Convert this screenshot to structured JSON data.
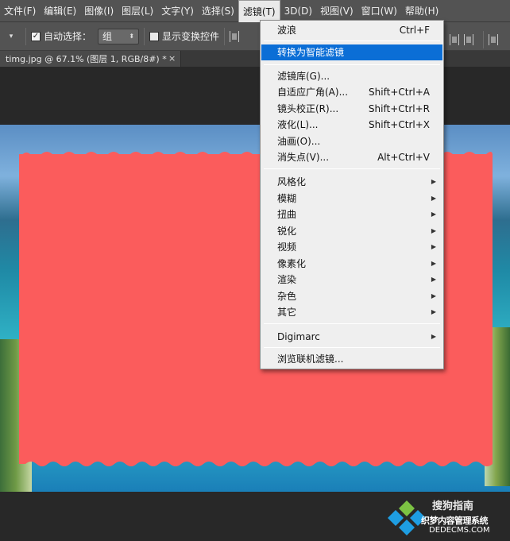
{
  "menubar": {
    "items": [
      "文件(F)",
      "编辑(E)",
      "图像(I)",
      "图层(L)",
      "文字(Y)",
      "选择(S)",
      "滤镜(T)",
      "3D(D)",
      "视图(V)",
      "窗口(W)",
      "帮助(H)"
    ],
    "active_index": 6
  },
  "options": {
    "auto_select_label": "自动选择：",
    "auto_select_checked": true,
    "auto_select_value": "组",
    "show_transform_label": "显示变换控件",
    "show_transform_checked": false
  },
  "document": {
    "tab_title": "timg.jpg @ 67.1% (图层 1, RGB/8#) *",
    "close_glyph": "×"
  },
  "filter_menu": {
    "last_filter": {
      "label": "波浪",
      "shortcut": "Ctrl+F"
    },
    "convert_smart": {
      "label": "转换为智能滤镜"
    },
    "group2": [
      {
        "label": "滤镜库(G)...",
        "shortcut": ""
      },
      {
        "label": "自适应广角(A)...",
        "shortcut": "Shift+Ctrl+A"
      },
      {
        "label": "镜头校正(R)...",
        "shortcut": "Shift+Ctrl+R"
      },
      {
        "label": "液化(L)...",
        "shortcut": "Shift+Ctrl+X"
      },
      {
        "label": "油画(O)...",
        "shortcut": ""
      },
      {
        "label": "消失点(V)...",
        "shortcut": "Alt+Ctrl+V"
      }
    ],
    "group3": [
      "风格化",
      "模糊",
      "扭曲",
      "锐化",
      "视频",
      "像素化",
      "渲染",
      "杂色",
      "其它"
    ],
    "digimarc": "Digimarc",
    "browse_online": "浏览联机滤镜..."
  },
  "watermark": {
    "line1": "搜狗指南",
    "line2": "织梦内容管理系统",
    "line3": "DEDECMS.COM"
  },
  "colors": {
    "menu_highlight": "#0b6ed6",
    "red_band": "#fb5c5c",
    "ui_dark": "#282828",
    "ui_panel": "#535353"
  }
}
